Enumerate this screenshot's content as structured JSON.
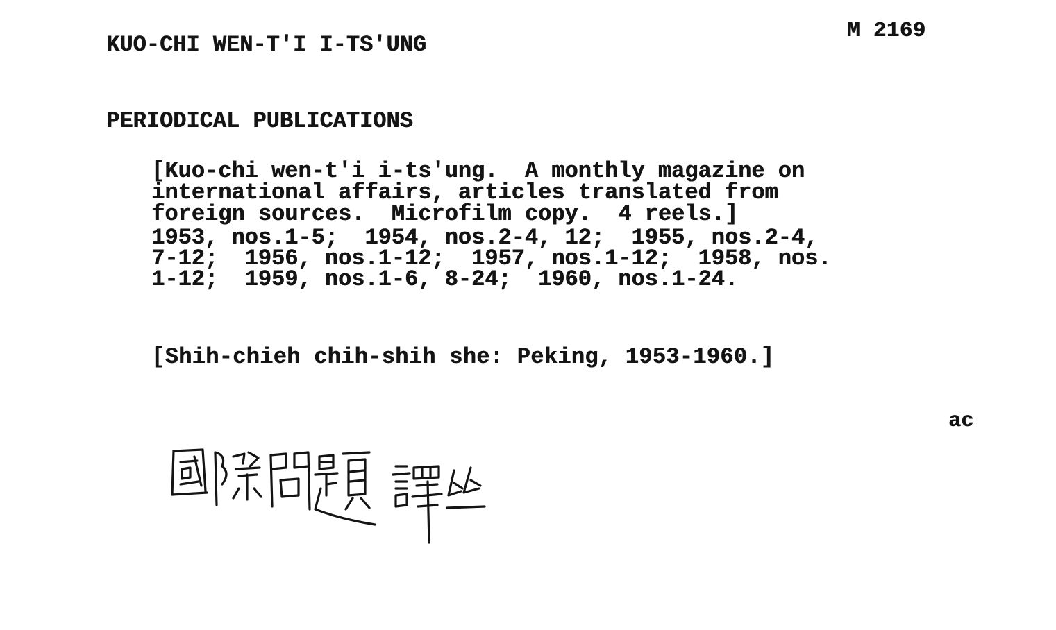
{
  "card": {
    "heading": "KUO-CHI WEN-T'I I-TS'UNG",
    "call_number": "M 2169",
    "subject": "PERIODICAL PUBLICATIONS",
    "body_lines": [
      "[Kuo-chi wen-t'i i-ts'ung.  A monthly magazine on",
      "international affairs, articles translated from",
      "foreign sources.  Microfilm copy.  4 reels.]",
      "1953, nos.1-5;  1954, nos.2-4, 12;  1955, nos.2-4,",
      "7-12;  1956, nos.1-12;  1957, nos.1-12;  1958, nos.",
      "1-12;  1959, nos.1-6, 8-24;  1960, nos.1-24."
    ],
    "publisher": "[Shih-chieh chih-shih she: Peking, 1953-1960.]",
    "initials": "ac",
    "chinese_title": "國際問題譯丛",
    "ink_color": "#141414",
    "paper_color": "#ffffff"
  }
}
